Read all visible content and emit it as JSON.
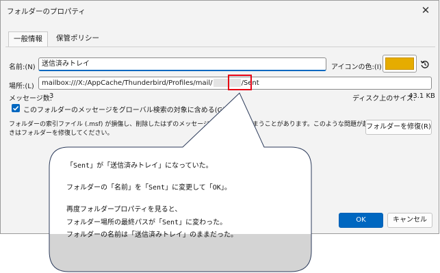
{
  "dialog": {
    "title": "フォルダーのプロパティ",
    "close_glyph": "✕"
  },
  "tabs": [
    {
      "label": "一般情報"
    },
    {
      "label": "保管ポリシー"
    }
  ],
  "general": {
    "name_label": "名前:(N)",
    "name_value": "送信済みトレイ",
    "icon_color_label": "アイコンの色:(I)",
    "icon_color": "#e6ac00",
    "location_label": "場所:(L)",
    "location_prefix": "mailbox:///X:/AppCache/Thunderbird/Profiles/mail/",
    "location_suffix": "/Sent",
    "message_count_label": "メッセージ数:",
    "message_count_value": "3",
    "disk_size_label": "ディスク上のサイズ:",
    "disk_size_value": "43.1 KB",
    "global_search_checkbox": "このフォルダーのメッセージをグローバル検索の対象に含める(G)",
    "global_search_checked": true,
    "repair_description_line1": "フォルダーの索引ファイル (.msf) が損傷し、削除したはずのメッセージが表示されてしまうことがあります。このような問題が起こったと",
    "repair_description_line2": "きはフォルダーを修復してください。",
    "repair_button": "フォルダーを修復(R)"
  },
  "buttons": {
    "ok": "OK",
    "cancel": "キャンセル"
  },
  "annotation": {
    "line1": "「Sent」が「送信済みトレイ」になっていた。",
    "line2": "フォルダーの「名前」を「Sent」に変更して「OK」。",
    "line3": "再度フォルダープロパティを見ると、",
    "line4": "フォルダー場所の最終パスが「Sent」に変わった。",
    "line5": "フォルダーの名前は「送信済みトレイ」のままだった。"
  },
  "colors": {
    "accent": "#0067c0",
    "highlight": "#e60012"
  }
}
